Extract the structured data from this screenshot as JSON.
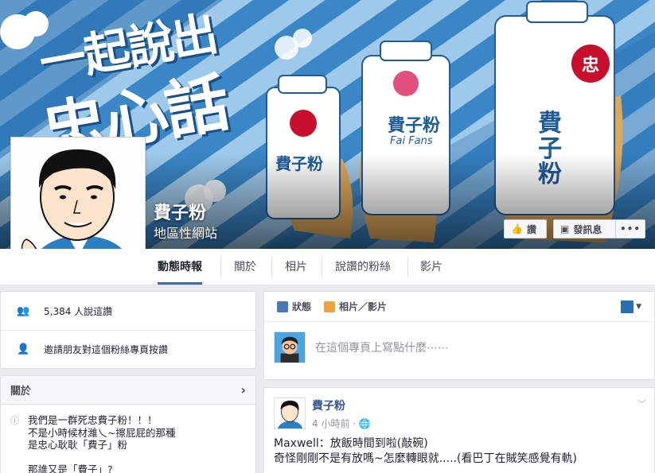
{
  "cover": {
    "title_line1": "一起說出",
    "title_line2": "忠心話",
    "carton_brand": "費子粉",
    "carton_sub": "Fai Fans",
    "carton_badge": "忠"
  },
  "page": {
    "name": "費子粉",
    "category": "地區性網站"
  },
  "cover_buttons": {
    "like_label": "讚",
    "message_label": "發訊息",
    "more_label": "•••"
  },
  "tabs": [
    {
      "label": "動態時報"
    },
    {
      "label": "關於"
    },
    {
      "label": "相片"
    },
    {
      "label": "說讚的粉絲"
    },
    {
      "label": "影片"
    }
  ],
  "sidebar": {
    "likes_text": "5,384 人說這讚",
    "invite_text": "邀請朋友對這個粉絲專頁按讚",
    "about_title": "關於",
    "about_lines": [
      "我們是一群死忠費子粉！！！",
      "不是小時候材濰乀~擦屁屁的那種",
      "是忠心耿耿「費子」粉",
      "",
      "那誰又是「費子」?"
    ]
  },
  "composer": {
    "status_label": "狀態",
    "photo_label": "相片／影片",
    "placeholder": "在這個專頁上寫點什麼⋯⋯"
  },
  "post": {
    "author": "費子粉",
    "time": "4 小時前 · ",
    "text_line1": "Maxwell：放飯時間到啦(敲碗)",
    "text_line2": "奇怪剛剛不是有放嗎~怎麼轉眼就.....(看巴丁在賊笑感覺有軌)"
  },
  "colors": {
    "accent": "#4267b2",
    "link": "#365899",
    "cover_blue": "#3a86c6",
    "cover_light": "#9ec9ea"
  }
}
